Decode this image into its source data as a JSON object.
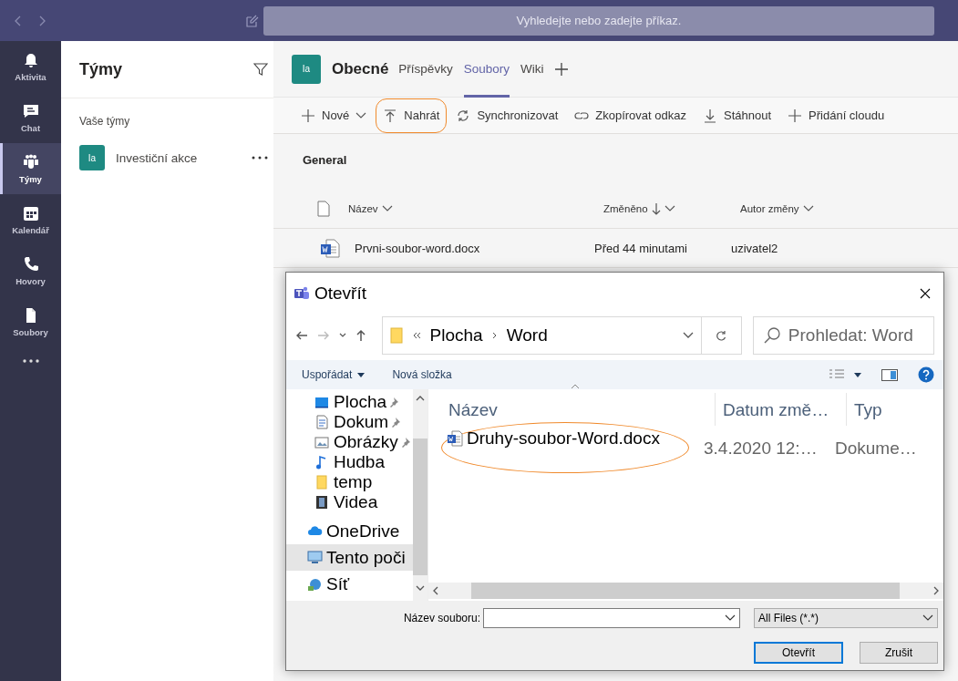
{
  "search": {
    "placeholder": "Vyhledejte nebo zadejte příkaz."
  },
  "rail": [
    {
      "label": "Aktivita",
      "kind": "bell",
      "selected": false
    },
    {
      "label": "Chat",
      "kind": "chat",
      "selected": false
    },
    {
      "label": "Týmy",
      "kind": "teams",
      "selected": true
    },
    {
      "label": "Kalendář",
      "kind": "calendar",
      "selected": false
    },
    {
      "label": "Hovory",
      "kind": "phone",
      "selected": false
    },
    {
      "label": "Soubory",
      "kind": "file",
      "selected": false
    }
  ],
  "teams_panel": {
    "title": "Týmy",
    "section": "Vaše týmy",
    "teams": [
      {
        "initials": "Ia",
        "name": "Investiční akce"
      }
    ]
  },
  "channel": {
    "initials": "Ia",
    "name": "Obecné",
    "tabs": [
      {
        "label": "Příspěvky",
        "selected": false
      },
      {
        "label": "Soubory",
        "selected": true
      },
      {
        "label": "Wiki",
        "selected": false
      }
    ]
  },
  "toolbar": [
    {
      "label": "Nové",
      "kind": "plus",
      "dropdown": true,
      "highlighted": false
    },
    {
      "label": "Nahrát",
      "kind": "upload",
      "dropdown": false,
      "highlighted": true
    },
    {
      "label": "Synchronizovat",
      "kind": "sync",
      "dropdown": false,
      "highlighted": false
    },
    {
      "label": "Zkopírovat odkaz",
      "kind": "link",
      "dropdown": false,
      "highlighted": false
    },
    {
      "label": "Stáhnout",
      "kind": "download",
      "dropdown": false,
      "highlighted": false
    },
    {
      "label": "Přidání cloudu",
      "kind": "plus",
      "dropdown": false,
      "highlighted": false
    }
  ],
  "library": {
    "title": "General",
    "columns": [
      {
        "label": "Název",
        "sorted": false
      },
      {
        "label": "Změněno",
        "sorted": true
      },
      {
        "label": "Autor změny",
        "sorted": false
      }
    ],
    "rows": [
      {
        "name": "Prvni-soubor-word.docx",
        "modified": "Před 44 minutami",
        "author": "uzivatel2"
      }
    ]
  },
  "dialog": {
    "title": "Otevřít",
    "path": [
      "Plocha",
      "Word"
    ],
    "search_placeholder": "Prohledat: Word",
    "commands": [
      "Uspořádat",
      "Nová složka"
    ],
    "quick_access": [
      {
        "label": "Plocha",
        "kind": "desktop",
        "pinned": true
      },
      {
        "label": "Dokum",
        "kind": "document",
        "pinned": true
      },
      {
        "label": "Obrázky",
        "kind": "pictures",
        "pinned": true
      },
      {
        "label": "Hudba",
        "kind": "music",
        "pinned": false
      },
      {
        "label": "temp",
        "kind": "folder",
        "pinned": false
      },
      {
        "label": "Videa",
        "kind": "video",
        "pinned": false
      }
    ],
    "locations": [
      {
        "label": "OneDrive",
        "kind": "cloud",
        "selected": false
      },
      {
        "label": "Tento poči",
        "kind": "computer",
        "selected": true
      },
      {
        "label": "Síť",
        "kind": "network",
        "selected": false
      }
    ],
    "columns": [
      "Název",
      "Datum změ…",
      "Typ"
    ],
    "files": [
      {
        "name": "Druhy-soubor-Word.docx",
        "date": "3.4.2020 12:…",
        "type": "Dokume…",
        "highlighted": true
      }
    ],
    "filename_label": "Název souboru:",
    "filter": "All Files (*.*)",
    "buttons": [
      {
        "label": "Otevřít",
        "default": true
      },
      {
        "label": "Zrušit",
        "default": false
      }
    ]
  }
}
